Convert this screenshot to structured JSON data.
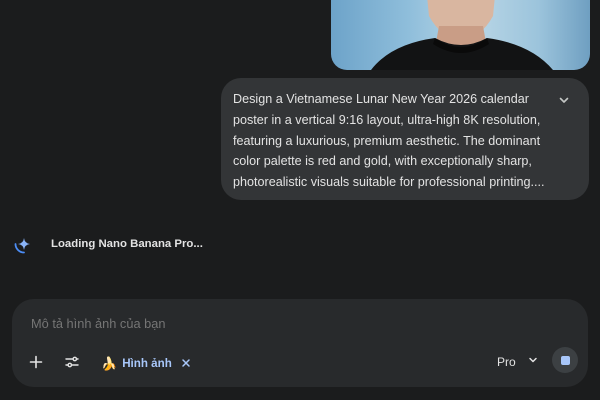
{
  "conversation": {
    "attached_image": {
      "description_icon": "portrait-photo"
    },
    "user_prompt": {
      "text": "Design a Vietnamese Lunar New Year 2026 calendar\nposter in a vertical 9:16 layout, ultra-high 8K resolution,\nfeaturing a luxurious, premium aesthetic. The dominant\ncolor palette is red and gold, with exceptionally sharp,\nphotorealistic visuals suitable for professional printing....",
      "expand_icon": "chevron-down-icon"
    },
    "status": {
      "loading_text": "Loading Nano Banana Pro...",
      "icon": "gemini-spark-spinner-icon"
    }
  },
  "composer": {
    "placeholder": "Mô tả hình ảnh của bạn",
    "add_icon": "plus-icon",
    "tools_icon": "tune-icon",
    "active_tool": {
      "emoji": "🍌",
      "label": "Hình ảnh",
      "close_icon": "close-icon"
    },
    "model": {
      "label": "Pro",
      "icon": "chevron-down-icon"
    },
    "stop_icon": "stop-icon"
  },
  "colors": {
    "background": "#1b1c1d",
    "bubble": "#333537",
    "composer": "#282a2c",
    "accent": "#a8c7fa",
    "text": "#e3e3e3"
  }
}
